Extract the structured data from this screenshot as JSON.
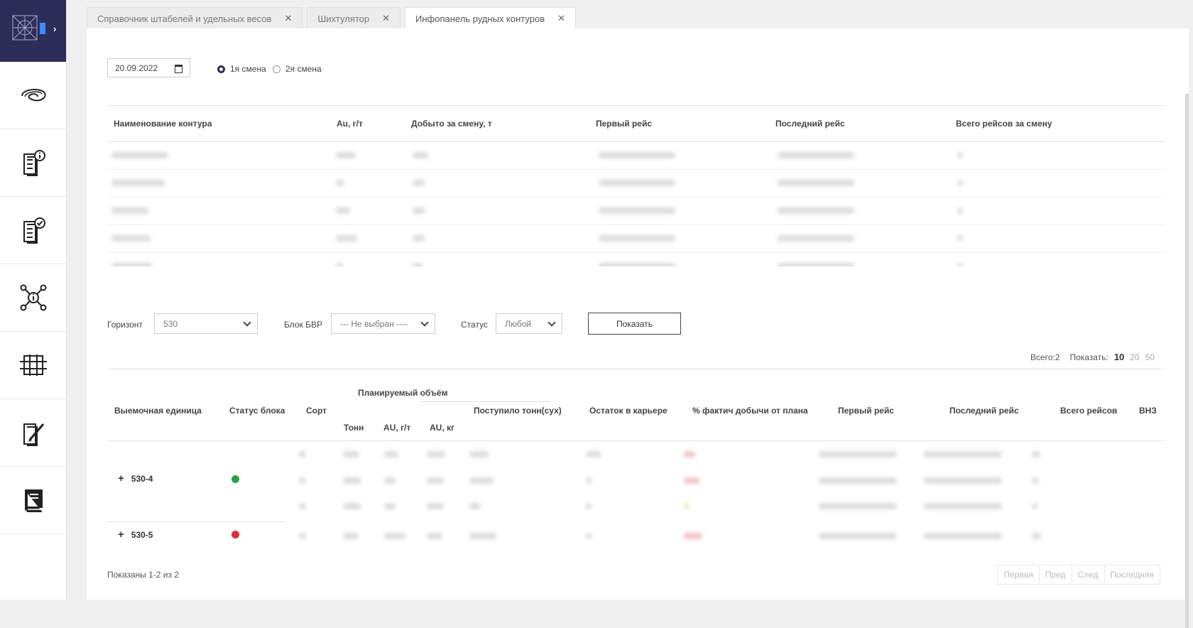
{
  "tabs": [
    {
      "label": "Справочник штабелей и удельных весов",
      "close": "✕"
    },
    {
      "label": "Шихтулятор",
      "close": "✕"
    },
    {
      "label": "Инфопанель рудных контуров",
      "close": "✕"
    }
  ],
  "date": {
    "value": "20.09.2022"
  },
  "shifts": [
    {
      "label": "1я смена",
      "selected": true
    },
    {
      "label": "2я смена",
      "selected": false
    }
  ],
  "contour_table": {
    "columns": [
      "Наименование контура",
      "Au, г/т",
      "Добыто за смену, т",
      "Первый рейс",
      "Последний рейс",
      "Всего рейсов за смену"
    ]
  },
  "filters": {
    "horizon_label": "Горизонт",
    "horizon_value": "530",
    "block_label": "Блок БВР",
    "block_value": "--- Не выбран ----",
    "status_label": "Статус",
    "status_value": "Любой",
    "show_button": "Показать"
  },
  "paging_top": {
    "total": "Всего:2",
    "show_label": "Показать:",
    "sizes": [
      "10",
      "20",
      "50"
    ]
  },
  "units_table": {
    "columns": {
      "unit": "Выемочная единица",
      "status": "Статус блока",
      "sort": "Сорт",
      "planned": "Планируемый объём",
      "tons": "Тонн",
      "au_gt": "AU, г/т",
      "au_kg": "AU, кг",
      "received": "Поступило тонн(сух)",
      "remaining": "Остаток в карьере",
      "percent": "% фактич добычи от плана",
      "first": "Первый рейс",
      "last": "Последний рейс",
      "total": "Всего рейсов",
      "vnz": "ВНЗ"
    },
    "groups": [
      {
        "name": "530-4",
        "expand": "+",
        "status_color": "#2ea043"
      },
      {
        "name": "530-5",
        "expand": "+",
        "status_color": "#d9303a"
      }
    ]
  },
  "footer": {
    "shown": "Показаны 1-2 из 2",
    "pager": [
      "Первая",
      "Пред",
      "След",
      "Последняя"
    ]
  }
}
